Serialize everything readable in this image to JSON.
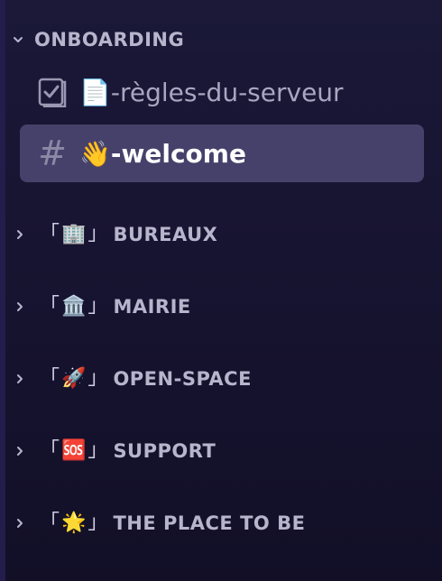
{
  "sidebar": {
    "expanded_category": {
      "label": "ONBOARDING",
      "channels": [
        {
          "label": "📄-règles-du-serveur",
          "icon": "rules-checkbox-icon",
          "selected": false
        },
        {
          "label": "👋-welcome",
          "icon": "hash-icon",
          "selected": true
        }
      ]
    },
    "hash_symbol": "#",
    "collapsed_categories": [
      {
        "open_bracket": "「",
        "emoji": "🏢",
        "close_bracket": "」",
        "label": "BUREAUX"
      },
      {
        "open_bracket": "「",
        "emoji": "🏛️",
        "close_bracket": "」",
        "label": "MAIRIE"
      },
      {
        "open_bracket": "「",
        "emoji": "🚀",
        "close_bracket": "」",
        "label": "OPEN-SPACE"
      },
      {
        "open_bracket": "「",
        "emoji": "🆘",
        "close_bracket": "」",
        "label": "SUPPORT"
      },
      {
        "open_bracket": "「",
        "emoji": "🌟",
        "close_bracket": "」",
        "label": "THE PLACE TO BE"
      }
    ]
  },
  "colors": {
    "background": "#171431",
    "selected_channel_bg": "#46416a",
    "category_text": "#b7b4cc",
    "channel_text": "#a9a6c0",
    "selected_text": "#ffffff"
  }
}
